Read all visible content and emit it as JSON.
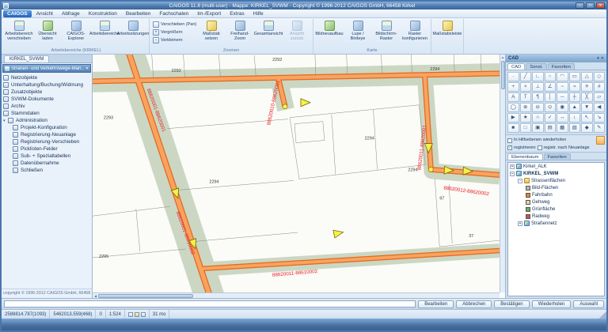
{
  "icons": {
    "app": "▦",
    "minimize": "–",
    "maximize": "□",
    "close": "✕",
    "dropdown": "▾",
    "expand": "+",
    "collapse": "−",
    "check": "✓",
    "plus": "+",
    "minus": "−",
    "arrow_up": "▲",
    "arrow_down": "▼",
    "arrow_left": "◀",
    "arrow_right": "▶"
  },
  "colors": {
    "road_fill": "#f9a35f",
    "road_edge": "#e2691e",
    "green_area": "#cbd7c3",
    "marker_yellow": "#f8ef4a",
    "label_red": "#e62222"
  },
  "titlebar": {
    "title": "CAIGOS 11.8 (multi-user)  -  Mappe: KIRKEL_SVWM  -  Copyright © 1996-2012 CAIGOS GmbH, 66458 Kirkel"
  },
  "menubar": {
    "items": [
      "CAIGOS",
      "Ansicht",
      "Abfrage",
      "Konstruktion",
      "Bearbeiten",
      "Fachschalen",
      "Im-/Export",
      "Extras",
      "Hilfe"
    ]
  },
  "ribbon": {
    "groups": [
      {
        "label": "Arbeitsbereiche (KIRKEL)",
        "buttons": [
          {
            "l1": "Arbeitsbereich",
            "l2": "verschieben"
          },
          {
            "l1": "Übersicht",
            "l2": "laden"
          },
          {
            "l1": "CAIGOS-",
            "l2": "Explorer"
          },
          {
            "l1": "Arbeitsbereiche",
            "l2": ""
          },
          {
            "l1": "Arbeitssitzungen",
            "l2": ""
          }
        ]
      },
      {
        "label": "Zoomen",
        "small": [
          "Verschieben (Pan)",
          "Vergrößern",
          "Verkleinern"
        ],
        "buttons": [
          {
            "l1": "Maßstab",
            "l2": "setzen"
          },
          {
            "l1": "Freihand-",
            "l2": "Zoom"
          },
          {
            "l1": "Gesamtansicht",
            "l2": ""
          },
          {
            "l1": "Ansicht",
            "l2": "zurück"
          }
        ]
      },
      {
        "label": "Karte",
        "buttons": [
          {
            "l1": "Bildneuaufbau",
            "l2": ""
          },
          {
            "l1": "Lupe /",
            "l2": "Birdeye"
          },
          {
            "l1": "Bildschirm-",
            "l2": "Raster"
          },
          {
            "l1": "Raster",
            "l2": "konfigurieren"
          }
        ]
      },
      {
        "label": "",
        "buttons": [
          {
            "l1": "Maßstabsleiste",
            "l2": ""
          }
        ]
      }
    ]
  },
  "left_panel": {
    "tab": "KIRKEL_SVWM",
    "header": "Straßen- und Verkehrswege-Man...",
    "items": [
      {
        "label": "Netzobjekte"
      },
      {
        "label": "Unterhaltung/Buchung/Widmung"
      },
      {
        "label": "Zusatzobjekte"
      },
      {
        "label": "SVWM-Dokumente"
      },
      {
        "label": "Archiv"
      },
      {
        "label": "Stammdaten"
      },
      {
        "label": "Administration"
      },
      {
        "label": "Projekt-Konfiguration"
      },
      {
        "label": "Registrierung-Neuanlage"
      },
      {
        "label": "Registrierung-Verschieben"
      },
      {
        "label": "Picklisten-Felder"
      },
      {
        "label": "Sub- + Spezialtabellen"
      },
      {
        "label": "Datenübernahme"
      },
      {
        "label": "Schließen"
      }
    ],
    "copyright": "copyright © 1996-2012 CAIGOS GmbH, 66458 ..."
  },
  "map": {
    "road_labels": [
      {
        "text": "88620001-88620001"
      },
      {
        "text": "88620010-88620001"
      },
      {
        "text": "88620011-88620001"
      },
      {
        "text": "88620012-88620002"
      },
      {
        "text": "88620001-88610002"
      },
      {
        "text": "88620011-88610002"
      }
    ],
    "parcel_labels": [
      {
        "text": "2292"
      },
      {
        "text": "2292"
      },
      {
        "text": "2293"
      },
      {
        "text": "2294"
      },
      {
        "text": "2294"
      },
      {
        "text": "2294"
      },
      {
        "text": "2294"
      },
      {
        "text": "2295"
      },
      {
        "text": "97"
      },
      {
        "text": "37"
      }
    ]
  },
  "cad_palette": {
    "title": "CAD",
    "tabs": [
      "CAD",
      "Sonst.",
      "Favoriten"
    ],
    "icons": [
      "·",
      "╱",
      "∟",
      "○",
      "◠",
      "▭",
      "△",
      "◇",
      "+",
      "×",
      "⊥",
      "∠",
      "~",
      "≈",
      "≡",
      "#",
      "A",
      "T",
      "¶",
      "│",
      "─",
      "┼",
      "╳",
      "▱",
      "◯",
      "⊕",
      "⊖",
      "⊙",
      "◉",
      "▲",
      "▼",
      "◀",
      "▶",
      "★",
      "☆",
      "✓",
      "↔",
      "↕",
      "↖",
      "↘",
      "■",
      "□",
      "▣",
      "▤",
      "▦",
      "▧",
      "◆",
      "✎"
    ],
    "checks": {
      "c1": "In Hilfsebenen wiederholen",
      "c2": "registrieren",
      "c3": "registr. nach Neuanlage"
    }
  },
  "layer_panel": {
    "tabs": [
      "Ebenenbaum",
      "Favoriten"
    ],
    "items": [
      {
        "label": "Kirkel_ALK"
      },
      {
        "label": "KIRKEL_SVWM"
      },
      {
        "label": "Strassenflächen"
      },
      {
        "label": "Bild-Flächen"
      },
      {
        "label": "Fahrbahn"
      },
      {
        "label": "Gehweg"
      },
      {
        "label": "Grünfläche"
      },
      {
        "label": "Radweg"
      },
      {
        "label": "Straßennetz"
      }
    ]
  },
  "bottombar": {
    "buttons": [
      "Bearbeiten",
      "Abbrechen",
      "Bestätigen",
      "Wiederholen",
      "Auswahl"
    ]
  },
  "statusbar": {
    "coord_x": "2588814.787(1093)",
    "coord_y": "5462013.559(468)",
    "val1": "0",
    "scale": "1:524",
    "mem": "31 mo"
  }
}
